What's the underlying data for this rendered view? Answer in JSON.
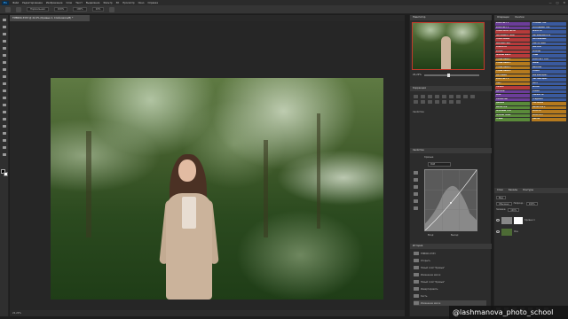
{
  "app": {
    "logo": "Ps",
    "menu": [
      "Файл",
      "Редактирование",
      "Изображение",
      "Слои",
      "Текст",
      "Выделение",
      "Фильтр",
      "3D",
      "Просмотр",
      "Окно",
      "Справка"
    ],
    "window_controls": [
      "—",
      "□",
      "✕"
    ]
  },
  "options_bar": {
    "mode": "Нормальная",
    "opacity": "100%",
    "flow": "100%",
    "smoothing": "10%"
  },
  "document": {
    "tab_title": "TMB000-3333 @ 22,2% (Кривые 1, Слой-маска/8) *",
    "status": "22,22%"
  },
  "toolbar": {
    "tools": [
      "move-tool",
      "marquee-tool",
      "lasso-tool",
      "quick-select-tool",
      "crop-tool",
      "eyedropper-tool",
      "healing-tool",
      "brush-tool",
      "clone-tool",
      "history-brush-tool",
      "eraser-tool",
      "gradient-tool",
      "blur-tool",
      "dodge-tool",
      "pen-tool",
      "type-tool",
      "path-select-tool",
      "shape-tool",
      "hand-tool",
      "zoom-tool"
    ],
    "foreground_color": "#000000",
    "background_color": "#ffffff"
  },
  "navigator": {
    "title": "Навигатор",
    "zoom": "22,22%"
  },
  "properties": {
    "title": "Свойства",
    "adjust_title": "Коррекция",
    "curves_label": "Кривые",
    "preset": "RGB",
    "input_label": "Вход:",
    "output_label": "Выход:"
  },
  "history": {
    "title": "История",
    "items": [
      "TMB000-3333",
      "Открыть",
      "Новый слой \"Кривые\"",
      "Изменение маски",
      "Новый слой \"Кривые\"",
      "Инвертировать",
      "Кисть",
      "Изменение маски"
    ],
    "active_index": 7
  },
  "actions": {
    "title_left": "Операции",
    "title_right": "Кнопки",
    "buttons": [
      {
        "label": "КОНТРАСТ 1",
        "color": "#6b3d99"
      },
      {
        "label": "ТЕПЛЫЙ ТОН",
        "color": "#3a5a9e"
      },
      {
        "label": "КОНТРАСТ 2",
        "color": "#6b3d99"
      },
      {
        "label": "ХОЛОДНЫЙ ТОН",
        "color": "#3a5a9e"
      },
      {
        "label": "ОСВЕТЛИТЬ СВЕТА",
        "color": "#b53b3b"
      },
      {
        "label": "ЯРКОСТЬ",
        "color": "#3a5a9e"
      },
      {
        "label": "ЗАТЕМНИТЬ ТЕНИ",
        "color": "#b53b3b"
      },
      {
        "label": "НАСЫЩЕННОСТЬ",
        "color": "#3a5a9e"
      },
      {
        "label": "ОСВЕТЛЕНИЕ",
        "color": "#b53b3b"
      },
      {
        "label": "ЗАТЕМНЕНИЕ",
        "color": "#3a5a9e"
      },
      {
        "label": "МЯГКИЙ СВЕТ",
        "color": "#b53b3b"
      },
      {
        "label": "СВЕТ И ТЕНЬ",
        "color": "#3a5a9e"
      },
      {
        "label": "РЕЗКОСТЬ",
        "color": "#b53b3b"
      },
      {
        "label": "ПОРТРЕТ",
        "color": "#3a5a9e"
      },
      {
        "label": "КОЖА",
        "color": "#b53b3b"
      },
      {
        "label": "ЗЕЛЕНЬ",
        "color": "#3a5a9e"
      },
      {
        "label": "ЗЕЛЕНЬ МЯГК.",
        "color": "#b53b3b"
      },
      {
        "label": "ТЕНИ",
        "color": "#3a5a9e"
      },
      {
        "label": "ТОНИРОВКА 1",
        "color": "#b57a1e"
      },
      {
        "label": "КОНТРАСТ ТОН",
        "color": "#3a5a9e"
      },
      {
        "label": "ТОНИРОВКА 2",
        "color": "#b57a1e"
      },
      {
        "label": "ЗАКАТ",
        "color": "#3a5a9e"
      },
      {
        "label": "ТОНИРОВКА 3",
        "color": "#b57a1e"
      },
      {
        "label": "ВИНТАЖ",
        "color": "#3a5a9e"
      },
      {
        "label": "ТОНИРОВКА 4",
        "color": "#b57a1e"
      },
      {
        "label": "ТЕПЛО",
        "color": "#3a5a9e"
      },
      {
        "label": "МАТОВЫЙ",
        "color": "#b57a1e"
      },
      {
        "label": "МЯГКИЙ ЦВЕТ",
        "color": "#3a5a9e"
      },
      {
        "label": "КОНТРАСТ 3",
        "color": "#b57a1e"
      },
      {
        "label": "ЧИСТЫЙ ЦВЕТ",
        "color": "#3a5a9e"
      },
      {
        "label": "СВЕТ",
        "color": "#b57a1e"
      },
      {
        "label": "ЛЕТО",
        "color": "#3a5a9e"
      },
      {
        "label": "ОБЪЕМ",
        "color": "#b53b3b"
      },
      {
        "label": "ВЕСНА",
        "color": "#3a5a9e"
      },
      {
        "label": "ДЕТАЛИ",
        "color": "#6b3d99"
      },
      {
        "label": "ОСЕНЬ",
        "color": "#3a5a9e"
      },
      {
        "label": "ФОН",
        "color": "#6b3d99"
      },
      {
        "label": "СВЕЖЕСТЬ",
        "color": "#3a5a9e"
      },
      {
        "label": "РАЗМЫТИЕ",
        "color": "#6b3d99"
      },
      {
        "label": "ГРАДИЕНТ",
        "color": "#3a5a9e"
      },
      {
        "label": "ДЫМКА",
        "color": "#5a8a3a"
      },
      {
        "label": "СВЕЧЕНИЕ",
        "color": "#b57a1e"
      },
      {
        "label": "ВИНЬЕТКА",
        "color": "#5a8a3a"
      },
      {
        "label": "ВИНЬЕТКА 2",
        "color": "#b57a1e"
      },
      {
        "label": "ЗЕЛЕНЫЙ ТОН",
        "color": "#5a8a3a"
      },
      {
        "label": "ЗОЛОТО",
        "color": "#b57a1e"
      },
      {
        "label": "ЗЕЛЕНЬ ТЕМН.",
        "color": "#5a8a3a"
      },
      {
        "label": "ЗОЛОТО 2",
        "color": "#b57a1e"
      },
      {
        "label": "ТРАВА",
        "color": "#5a8a3a"
      },
      {
        "label": "ЦВЕТЫ",
        "color": "#b57a1e"
      }
    ]
  },
  "layers": {
    "tabs": [
      "Слои",
      "Каналы",
      "Контуры"
    ],
    "kind": "Вид",
    "blend": "Обычные",
    "opacity_label": "Непрозр.:",
    "opacity": "100%",
    "fill_label": "Заливка:",
    "fill": "100%",
    "items": [
      {
        "name": "Кривые 1",
        "thumb": "#888888",
        "has_mask": true
      },
      {
        "name": "Фон",
        "thumb": "#4d6b35",
        "has_mask": false
      }
    ]
  },
  "watermark": "@lashmanova_photo_school"
}
